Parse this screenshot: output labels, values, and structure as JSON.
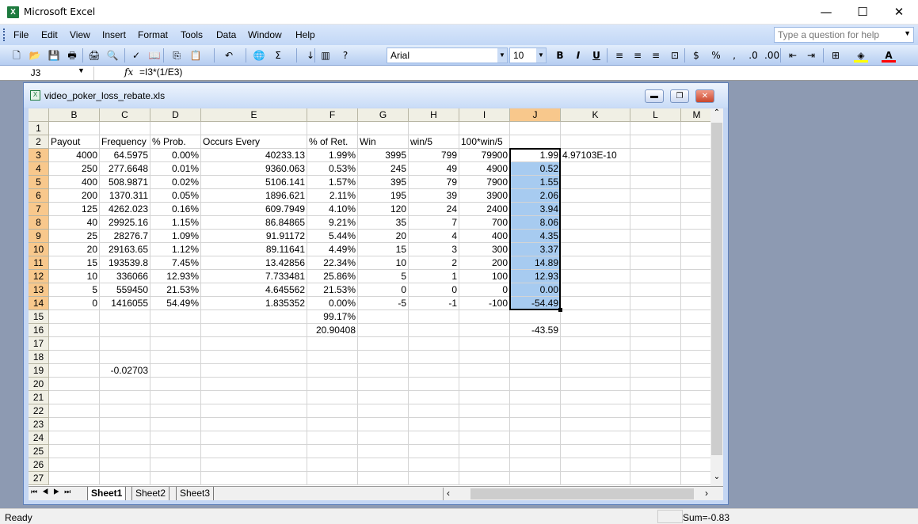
{
  "app": {
    "title": "Microsoft Excel",
    "window_controls": [
      "minimize",
      "maximize",
      "close"
    ]
  },
  "menu": [
    "File",
    "Edit",
    "View",
    "Insert",
    "Format",
    "Tools",
    "Data",
    "Window",
    "Help"
  ],
  "help_box": {
    "placeholder": "Type a question for help"
  },
  "toolbar": {
    "icons": [
      "new-icon",
      "open-icon",
      "save-icon",
      "permission-icon",
      "print-icon",
      "print-preview-icon",
      "spelling-icon",
      "research-icon",
      "copy-icon",
      "paste-icon",
      "undo-icon",
      "hyperlink-icon",
      "autosum-icon",
      "sort-ascending-icon",
      "chart-wizard-icon",
      "help-icon"
    ],
    "font": "Arial",
    "size": "10",
    "format_icons": [
      "bold-icon",
      "italic-icon",
      "underline-icon",
      "align-left-icon",
      "align-center-icon",
      "align-right-icon",
      "merge-center-icon",
      "currency-icon",
      "percent-icon",
      "comma-icon",
      "increase-decimal-icon",
      "decrease-decimal-icon",
      "decrease-indent-icon",
      "increase-indent-icon",
      "borders-icon",
      "fill-color-icon",
      "font-color-icon"
    ],
    "fill_color": "#ffff00",
    "font_color": "#ff0000"
  },
  "formula_bar": {
    "name_box": "J3",
    "fx": "fx",
    "formula": "=I3*(1/E3)"
  },
  "workbook": {
    "title": "video_poker_loss_rebate.xls"
  },
  "columns": [
    "B",
    "C",
    "D",
    "E",
    "F",
    "G",
    "H",
    "I",
    "J",
    "K",
    "L",
    "M"
  ],
  "selected_column": "J",
  "active_cell": "J3",
  "selection": "J3:J14",
  "rows": [
    {
      "n": "1",
      "cells": {}
    },
    {
      "n": "2",
      "cells": {
        "B": "Payout",
        "C": "Frequency",
        "D": "% Prob.",
        "E": "Occurs Every",
        "F": "% of Ret.",
        "G": "Win",
        "H": "win/5",
        "I": "100*win/5"
      }
    },
    {
      "n": "3",
      "cells": {
        "B": "4000",
        "C": "64.5975",
        "D": "0.00%",
        "E": "40233.13",
        "F": "1.99%",
        "G": "3995",
        "H": "799",
        "I": "79900",
        "J": "1.99",
        "K": "4.97103E-10"
      }
    },
    {
      "n": "4",
      "cells": {
        "B": "250",
        "C": "277.6648",
        "D": "0.01%",
        "E": "9360.063",
        "F": "0.53%",
        "G": "245",
        "H": "49",
        "I": "4900",
        "J": "0.52"
      }
    },
    {
      "n": "5",
      "cells": {
        "B": "400",
        "C": "508.9871",
        "D": "0.02%",
        "E": "5106.141",
        "F": "1.57%",
        "G": "395",
        "H": "79",
        "I": "7900",
        "J": "1.55"
      }
    },
    {
      "n": "6",
      "cells": {
        "B": "200",
        "C": "1370.311",
        "D": "0.05%",
        "E": "1896.621",
        "F": "2.11%",
        "G": "195",
        "H": "39",
        "I": "3900",
        "J": "2.06"
      }
    },
    {
      "n": "7",
      "cells": {
        "B": "125",
        "C": "4262.023",
        "D": "0.16%",
        "E": "609.7949",
        "F": "4.10%",
        "G": "120",
        "H": "24",
        "I": "2400",
        "J": "3.94"
      }
    },
    {
      "n": "8",
      "cells": {
        "B": "40",
        "C": "29925.16",
        "D": "1.15%",
        "E": "86.84865",
        "F": "9.21%",
        "G": "35",
        "H": "7",
        "I": "700",
        "J": "8.06"
      }
    },
    {
      "n": "9",
      "cells": {
        "B": "25",
        "C": "28276.7",
        "D": "1.09%",
        "E": "91.91172",
        "F": "5.44%",
        "G": "20",
        "H": "4",
        "I": "400",
        "J": "4.35"
      }
    },
    {
      "n": "10",
      "cells": {
        "B": "20",
        "C": "29163.65",
        "D": "1.12%",
        "E": "89.11641",
        "F": "4.49%",
        "G": "15",
        "H": "3",
        "I": "300",
        "J": "3.37"
      }
    },
    {
      "n": "11",
      "cells": {
        "B": "15",
        "C": "193539.8",
        "D": "7.45%",
        "E": "13.42856",
        "F": "22.34%",
        "G": "10",
        "H": "2",
        "I": "200",
        "J": "14.89"
      }
    },
    {
      "n": "12",
      "cells": {
        "B": "10",
        "C": "336066",
        "D": "12.93%",
        "E": "7.733481",
        "F": "25.86%",
        "G": "5",
        "H": "1",
        "I": "100",
        "J": "12.93"
      }
    },
    {
      "n": "13",
      "cells": {
        "B": "5",
        "C": "559450",
        "D": "21.53%",
        "E": "4.645562",
        "F": "21.53%",
        "G": "0",
        "H": "0",
        "I": "0",
        "J": "0.00"
      }
    },
    {
      "n": "14",
      "cells": {
        "B": "0",
        "C": "1416055",
        "D": "54.49%",
        "E": "1.835352",
        "F": "0.00%",
        "G": "-5",
        "H": "-1",
        "I": "-100",
        "J": "-54.49"
      }
    },
    {
      "n": "15",
      "cells": {
        "F": "99.17%"
      }
    },
    {
      "n": "16",
      "cells": {
        "F": "20.90408",
        "J": "-43.59"
      }
    },
    {
      "n": "17",
      "cells": {}
    },
    {
      "n": "18",
      "cells": {}
    },
    {
      "n": "19",
      "cells": {
        "C": "-0.02703"
      }
    },
    {
      "n": "20",
      "cells": {}
    },
    {
      "n": "21",
      "cells": {}
    },
    {
      "n": "22",
      "cells": {}
    },
    {
      "n": "23",
      "cells": {}
    },
    {
      "n": "24",
      "cells": {}
    },
    {
      "n": "25",
      "cells": {}
    },
    {
      "n": "26",
      "cells": {}
    },
    {
      "n": "27",
      "cells": {}
    }
  ],
  "sheets": [
    "Sheet1",
    "Sheet2",
    "Sheet3"
  ],
  "active_sheet": "Sheet1",
  "status": {
    "left": "Ready",
    "sum": "Sum=-0.83"
  },
  "colors": {
    "selection_fill": "#a7cbf0",
    "header_selected": "#f8c88c",
    "menubar": "#c2d7f6"
  }
}
